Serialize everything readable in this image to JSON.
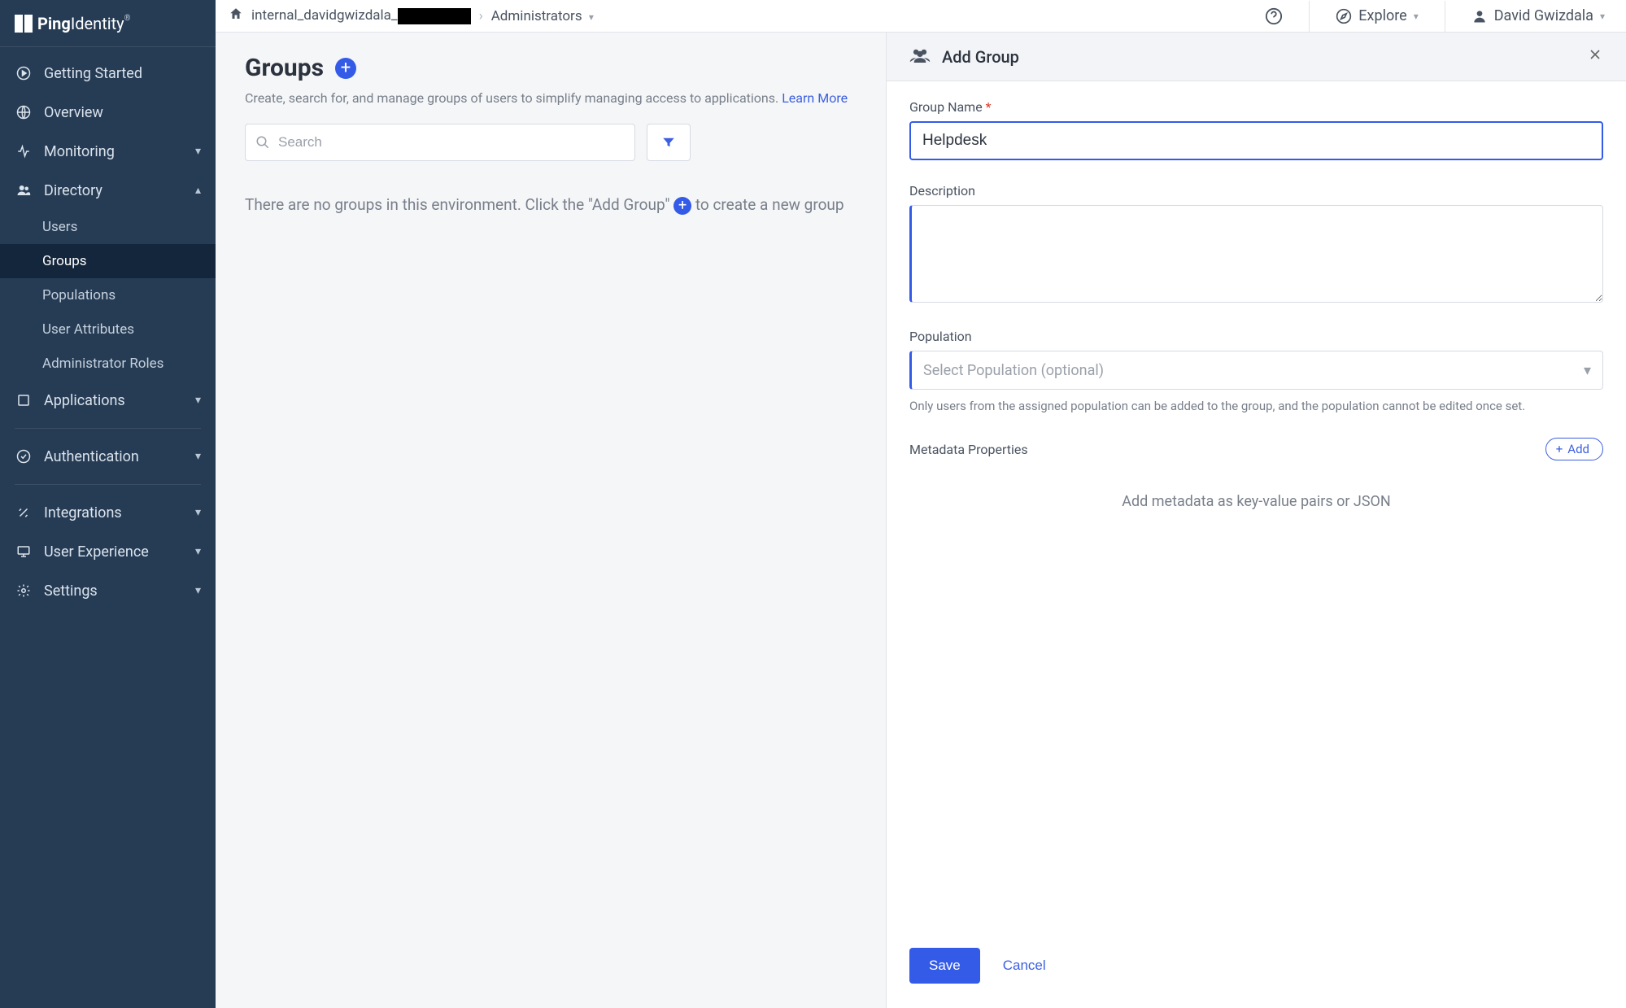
{
  "brand": {
    "name": "Ping",
    "suffix": "Identity"
  },
  "breadcrumb": {
    "env_prefix": "internal_davidgwizdala_",
    "section": "Administrators"
  },
  "topbar": {
    "explore": "Explore",
    "user": "David Gwizdala"
  },
  "sidebar": {
    "items": [
      {
        "label": "Getting Started"
      },
      {
        "label": "Overview"
      },
      {
        "label": "Monitoring"
      },
      {
        "label": "Directory",
        "expanded": true,
        "children": [
          {
            "label": "Users"
          },
          {
            "label": "Groups",
            "active": true
          },
          {
            "label": "Populations"
          },
          {
            "label": "User Attributes"
          },
          {
            "label": "Administrator Roles"
          }
        ]
      },
      {
        "label": "Applications"
      },
      {
        "label": "Authentication"
      },
      {
        "label": "Integrations"
      },
      {
        "label": "User Experience"
      },
      {
        "label": "Settings"
      }
    ]
  },
  "page": {
    "title": "Groups",
    "subtitle": "Create, search for, and manage groups of users to simplify managing access to applications. ",
    "learn_more": "Learn More",
    "search_placeholder": "Search",
    "empty_before": "There are no groups in this environment. Click the \"Add Group\" ",
    "empty_after": " to create a new group"
  },
  "panel": {
    "title": "Add Group",
    "group_name_label": "Group Name",
    "group_name_value": "Helpdesk",
    "description_label": "Description",
    "population_label": "Population",
    "population_placeholder": "Select Population (optional)",
    "population_help": "Only users from the assigned population can be added to the group, and the population cannot be edited once set.",
    "metadata_label": "Metadata Properties",
    "add_btn": "Add",
    "metadata_placeholder": "Add metadata as key-value pairs or JSON",
    "save": "Save",
    "cancel": "Cancel"
  }
}
